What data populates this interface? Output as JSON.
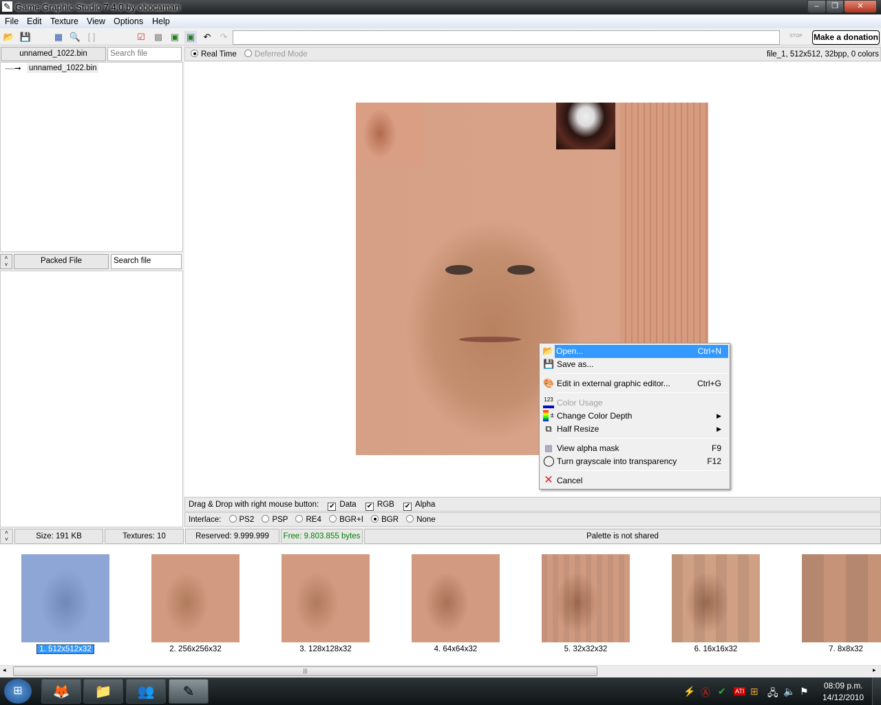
{
  "window": {
    "title": "Game Graphic Studio 7.4.0 by obocaman",
    "minimize": "–",
    "restore": "❐",
    "close": "✕"
  },
  "menu": [
    "File",
    "Edit",
    "Texture",
    "View",
    "Options",
    "Help"
  ],
  "toolbar": {
    "stop_label": "STOP",
    "donate_label": "Make a donation",
    "path_value": ""
  },
  "left": {
    "file_button": "unnamed_1022.bin",
    "search_placeholder": "Search file",
    "tree_item": "unnamed_1022.bin",
    "packed_button": "Packed File",
    "packed_search_placeholder": "Search file"
  },
  "mode": {
    "realtime": "Real Time",
    "deferred": "Deferred Mode",
    "realtime_selected": true,
    "file_info": "file_1, 512x512, 32bpp, 0 colors"
  },
  "dragdrop": {
    "label": "Drag & Drop with right mouse button:",
    "options": [
      {
        "label": "Data",
        "checked": true
      },
      {
        "label": "RGB",
        "checked": true
      },
      {
        "label": "Alpha",
        "checked": true
      }
    ]
  },
  "interlace": {
    "label": "Interlace:",
    "options": [
      "PS2",
      "PSP",
      "RE4",
      "BGR+I",
      "BGR",
      "None"
    ],
    "selected": "BGR"
  },
  "status": {
    "size": "Size: 191 KB",
    "textures": "Textures: 10",
    "reserved": "Reserved: 9.999.999 bytes",
    "free": "Free: 9.803.855 bytes",
    "palette": "Palette is not shared",
    "free_color": "#008000"
  },
  "thumbnails": [
    {
      "label": "1. 512x512x32",
      "selected": true
    },
    {
      "label": "2. 256x256x32"
    },
    {
      "label": "3. 128x128x32"
    },
    {
      "label": "4. 64x64x32"
    },
    {
      "label": "5. 32x32x32"
    },
    {
      "label": "6. 16x16x32"
    },
    {
      "label": "7. 8x8x32"
    }
  ],
  "context_menu": {
    "items": [
      {
        "label": "Open...",
        "shortcut": "Ctrl+N",
        "icon": "open-folder-icon",
        "highlighted": true
      },
      {
        "label": "Save as...",
        "shortcut": "",
        "icon": "save-icon"
      },
      {
        "label": "Edit in external graphic editor...",
        "shortcut": "Ctrl+G",
        "icon": "palette-icon"
      },
      {
        "label": "Color Usage",
        "shortcut": "",
        "icon": "color-usage-icon",
        "disabled": true
      },
      {
        "label": "Change Color Depth",
        "shortcut": "",
        "icon": "color-depth-icon",
        "submenu": true
      },
      {
        "label": "Half Resize",
        "shortcut": "",
        "icon": "resize-icon",
        "submenu": true
      },
      {
        "label": "View alpha mask",
        "shortcut": "F9",
        "icon": "alpha-mask-icon"
      },
      {
        "label": "Turn grayscale into transparency",
        "shortcut": "F12",
        "icon": "circle-icon"
      },
      {
        "label": "Cancel",
        "shortcut": "",
        "icon": "cancel-x-icon"
      }
    ],
    "highlight_color": "#3399ff"
  },
  "taskbar": {
    "time": "08:09 p.m.",
    "date": "14/12/2010"
  },
  "accent": "#3399ff"
}
